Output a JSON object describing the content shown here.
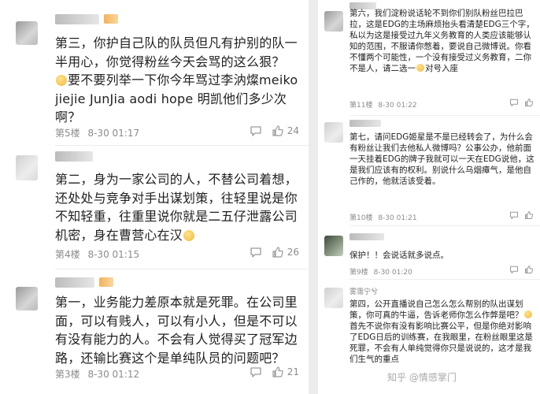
{
  "left": {
    "comments": [
      {
        "text": "第三，你护自己队的队员但凡有护别的队一半用心，你觉得粉丝今天会骂的这么狠？",
        "text2": "要不要列举一下你今年骂过李汭燦meiko jiejie JunJia aodi hope 明凯他们多少次啊？",
        "floor": "第5楼",
        "time": "8-30 01:17",
        "likes": "24"
      },
      {
        "text": "第二，身为一家公司的人，不替公司着想，还处处与竞争对手出谋划策，往轻里说是你不知轻重，往重里说你就是二五仔泄露公司机密，身在曹营心在汉",
        "floor": "第4楼",
        "time": "8-30 01:15",
        "likes": "26"
      },
      {
        "text": "第一，业务能力差原本就是死罪。在公司里面，可以有贱人，可以有小人，但是不可以有没有能力的人。不会有人觉得买了冠军边路，还输比赛这个是单纯队员的问题吧？",
        "floor": "第3楼",
        "time": "8-30 01:12",
        "likes": "21"
      }
    ]
  },
  "right": {
    "comments": [
      {
        "text": "第六，我们淀粉说话轮不到你们别队粉丝巴拉巴拉，这是EDG的主场麻烦抬头看清楚EDG三个字，私以为这是接受过九年义务教育的人类应该能够认知的范围，不服请你憋着，要说自己微博说。你看不懂两个可能性，一个没有接受过义务教育，二你不是人，请二选一",
        "text_suffix": "对号入座",
        "floor": "第11楼",
        "time": "8-30 01:22"
      },
      {
        "text": "第七，请问EDG姬星是不是已经转会了，为什么会有粉丝让我们去他私人微博吗？公事公办，他前面一天挂着EDG的牌子我就可以一天在EDG说他，这是我们应该有的权利。别说什么乌烟瘴气，是他自己作的，他就活该受着。",
        "floor": "第10楼",
        "time": "8-30 01:21"
      },
      {
        "text": "保护！！会说话就多说点。",
        "floor": "第9楼",
        "time": "8-30 01:20"
      },
      {
        "username": "雾霭宁兮",
        "text": "第四，公开直播说自己怎么怎么帮别的队出谋划策，你可真的牛逼，告诉老师你怎么作弊是吧？",
        "text2": "首先不说你有没有影响比赛公平，但是你绝对影响了EDG日后的训练赛，在我眼里，在粉丝眼里这是死罪，不会有人单纯觉得你只是说说的，这才是我们生气的重点"
      }
    ]
  },
  "watermark": "知乎 @情感掌门",
  "icons": [
    "comment-icon",
    "like-icon",
    "smile-emoji"
  ]
}
